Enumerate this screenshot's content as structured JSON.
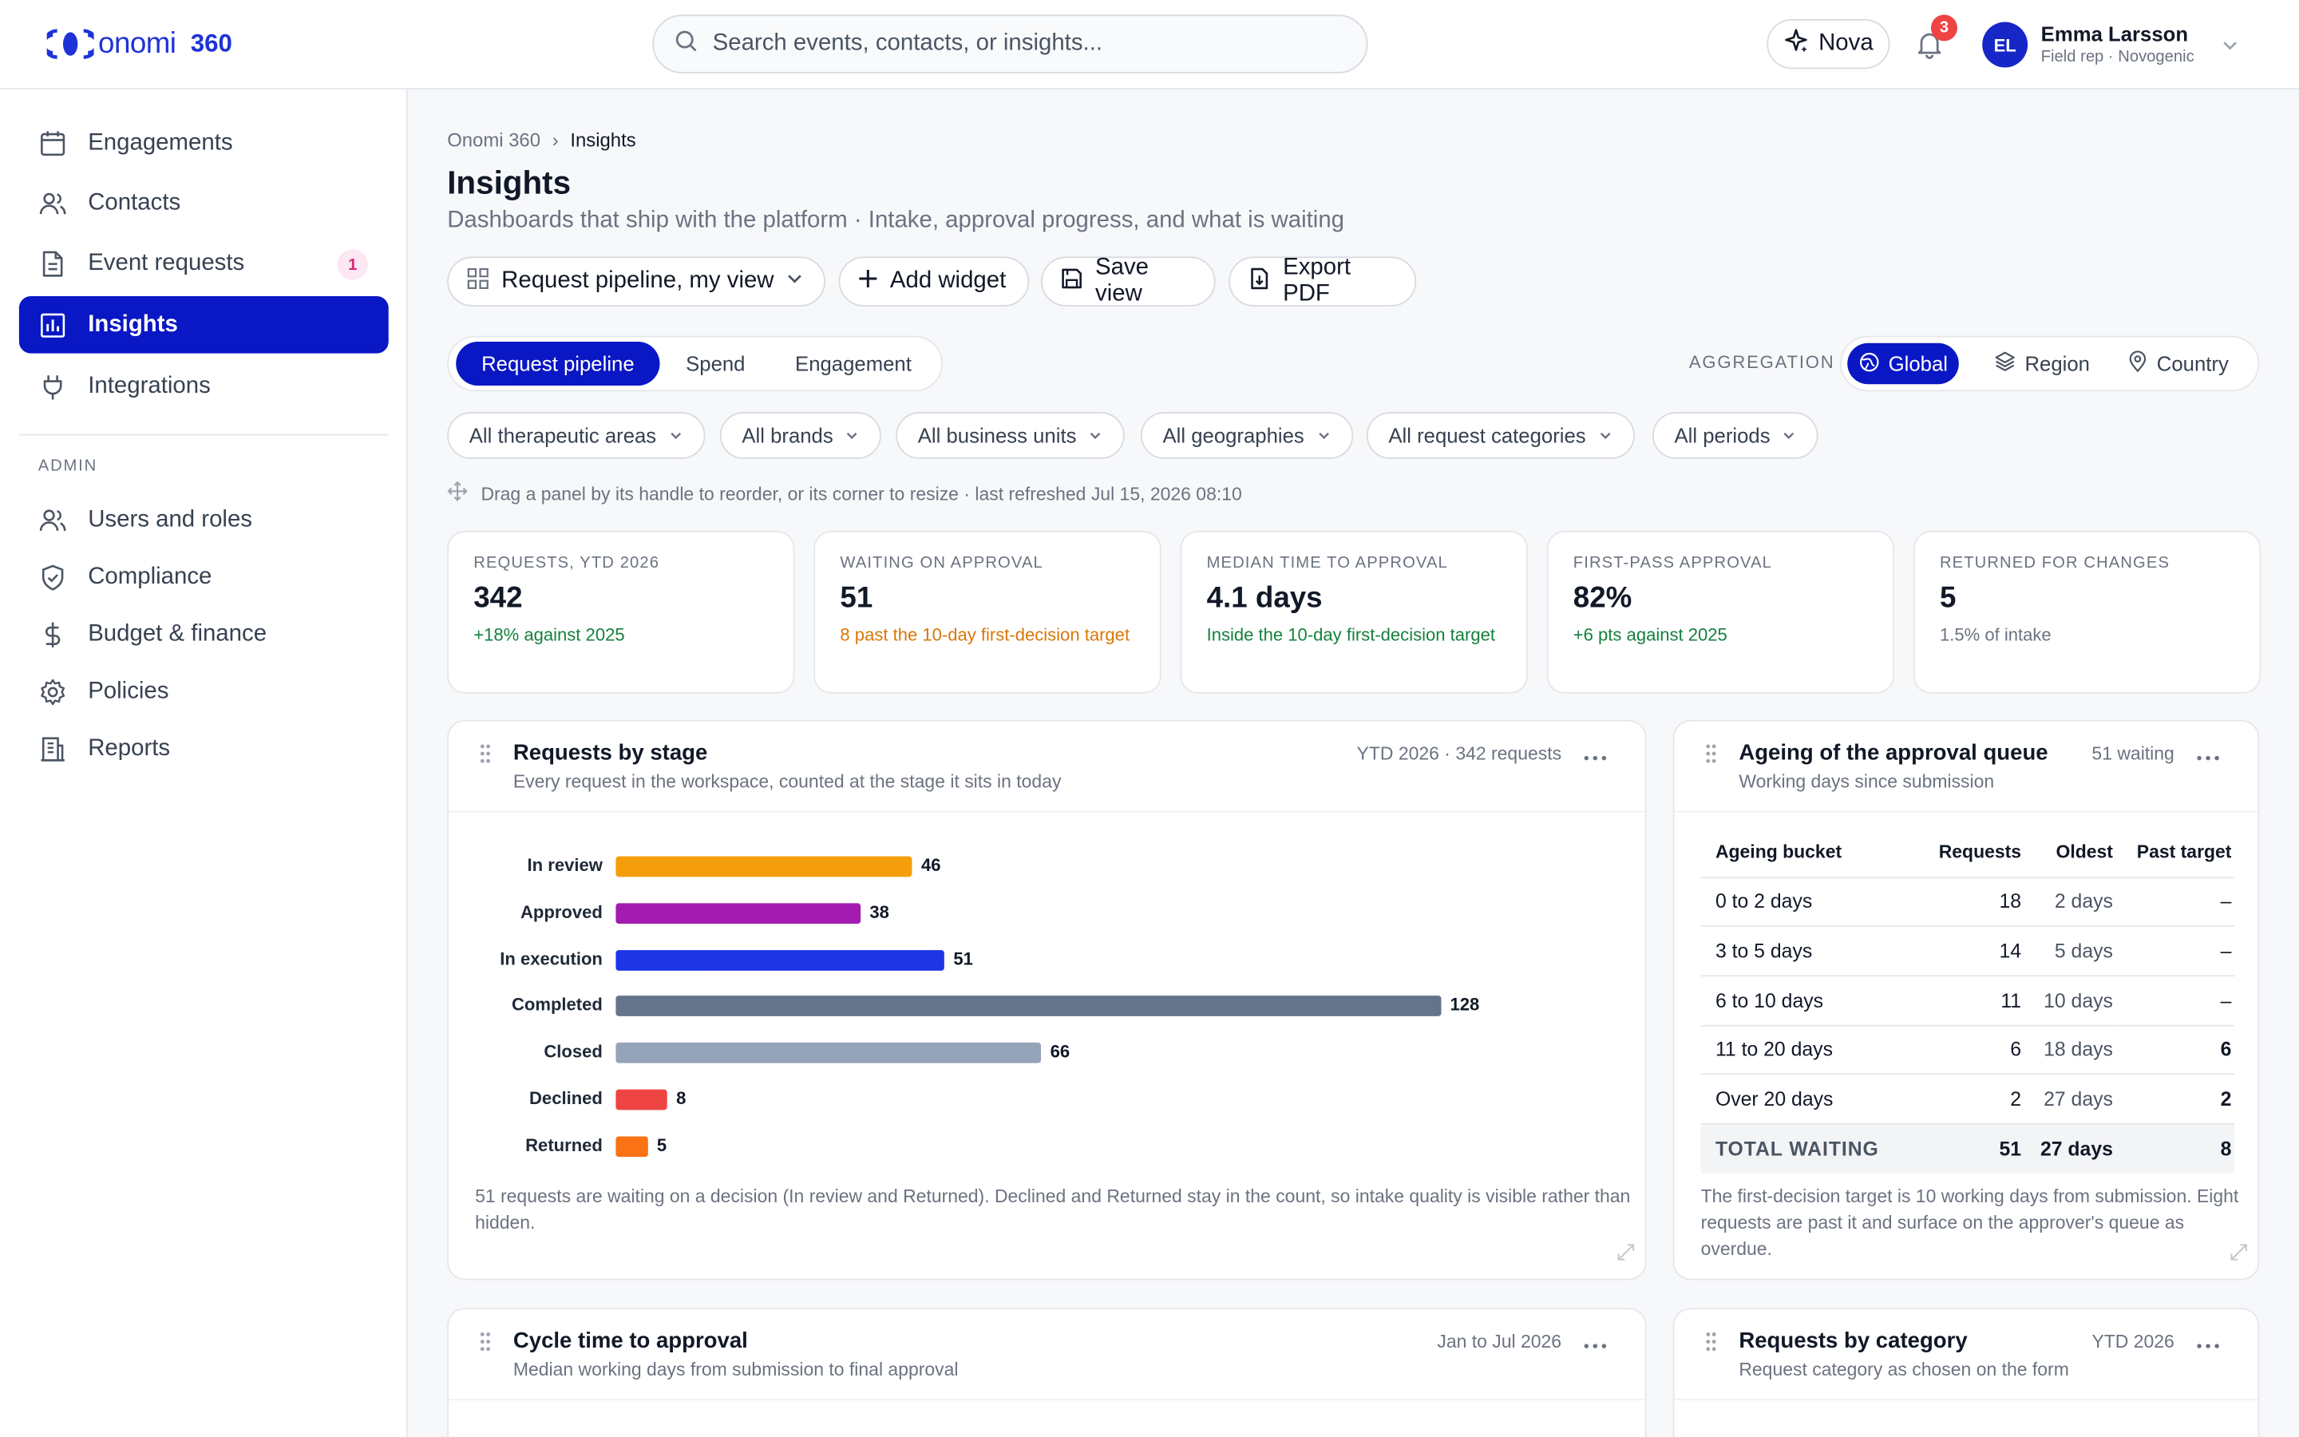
{
  "app": {
    "name": "onomi",
    "suffix": "360"
  },
  "search": {
    "placeholder": "Search events, contacts, or insights..."
  },
  "header": {
    "assistant": "Nova",
    "notifications": "3"
  },
  "user": {
    "initials": "EL",
    "name": "Emma Larsson",
    "role": "Field rep · Novogenic"
  },
  "sidebar": {
    "items": [
      {
        "label": "Engagements",
        "icon": "calendar-icon"
      },
      {
        "label": "Contacts",
        "icon": "users-icon"
      },
      {
        "label": "Event requests",
        "icon": "document-icon",
        "badge": "1"
      },
      {
        "label": "Insights",
        "icon": "bar-chart-icon",
        "active": true
      },
      {
        "label": "Integrations",
        "icon": "plug-icon"
      }
    ],
    "admin_label": "ADMIN",
    "admin_items": [
      {
        "label": "Users and roles",
        "icon": "users-icon"
      },
      {
        "label": "Compliance",
        "icon": "shield-icon"
      },
      {
        "label": "Budget & finance",
        "icon": "dollar-icon"
      },
      {
        "label": "Policies",
        "icon": "gear-icon"
      },
      {
        "label": "Reports",
        "icon": "building-icon"
      }
    ]
  },
  "breadcrumb": {
    "root": "Onomi 360",
    "current": "Insights"
  },
  "page": {
    "title": "Insights",
    "subtitle": "Dashboards that ship with the platform · Intake, approval progress, and what is waiting"
  },
  "toolbar": {
    "view": "Request pipeline, my view",
    "add_widget": "Add widget",
    "save_view": "Save view",
    "export_pdf": "Export PDF"
  },
  "tabs": [
    "Request pipeline",
    "Spend",
    "Engagement"
  ],
  "aggregation": {
    "label": "AGGREGATION",
    "options": [
      "Global",
      "Region",
      "Country"
    ],
    "selected": "Global"
  },
  "filters": [
    "All therapeutic areas",
    "All brands",
    "All business units",
    "All geographies",
    "All request categories",
    "All periods"
  ],
  "hint": "Drag a panel by its handle to reorder, or its corner to resize · last refreshed Jul 15, 2026 08:10",
  "kpis": [
    {
      "label": "REQUESTS, YTD 2026",
      "value": "342",
      "note": "+18% against 2025",
      "tone": "green"
    },
    {
      "label": "WAITING ON APPROVAL",
      "value": "51",
      "note": "8 past the 10-day first-decision target",
      "tone": "orange"
    },
    {
      "label": "MEDIAN TIME TO APPROVAL",
      "value": "4.1 days",
      "note": "Inside the 10-day first-decision target",
      "tone": "green"
    },
    {
      "label": "FIRST-PASS APPROVAL",
      "value": "82%",
      "note": "+6 pts against 2025",
      "tone": "green"
    },
    {
      "label": "RETURNED FOR CHANGES",
      "value": "5",
      "note": "1.5% of intake",
      "tone": "gray"
    }
  ],
  "stage_panel": {
    "title": "Requests by stage",
    "subtitle": "Every request in the workspace, counted at the stage it sits in today",
    "meta": "YTD 2026 · 342 requests",
    "footer": "51 requests are waiting on a decision (In review and Returned). Declined and Returned stay in the count, so intake quality is visible rather than hidden."
  },
  "chart_data": {
    "type": "bar",
    "orientation": "horizontal",
    "categories": [
      "In review",
      "Approved",
      "In execution",
      "Completed",
      "Closed",
      "Declined",
      "Returned"
    ],
    "values": [
      46,
      38,
      51,
      128,
      66,
      8,
      5
    ],
    "colors": [
      "#f59e0b",
      "#a21caf",
      "#1d35e5",
      "#64748b",
      "#94a3b8",
      "#ef4444",
      "#f97316"
    ],
    "xlim": [
      0,
      128
    ]
  },
  "ageing_panel": {
    "title": "Ageing of the approval queue",
    "subtitle": "Working days since submission",
    "meta": "51 waiting",
    "columns": [
      "Ageing bucket",
      "Requests",
      "Oldest",
      "Past target"
    ],
    "rows": [
      {
        "bucket": "0 to 2 days",
        "requests": "18",
        "oldest": "2 days",
        "past": "–"
      },
      {
        "bucket": "3 to 5 days",
        "requests": "14",
        "oldest": "5 days",
        "past": "–"
      },
      {
        "bucket": "6 to 10 days",
        "requests": "11",
        "oldest": "10 days",
        "past": "–"
      },
      {
        "bucket": "11 to 20 days",
        "requests": "6",
        "oldest": "18 days",
        "past": "6"
      },
      {
        "bucket": "Over 20 days",
        "requests": "2",
        "oldest": "27 days",
        "past": "2"
      }
    ],
    "total": {
      "bucket": "TOTAL WAITING",
      "requests": "51",
      "oldest": "27 days",
      "past": "8"
    },
    "footer": "The first-decision target is 10 working days from submission. Eight requests are past it and surface on the approver's queue as overdue."
  },
  "cycle_panel": {
    "title": "Cycle time to approval",
    "subtitle": "Median working days from submission to final approval",
    "meta": "Jan to Jul 2026"
  },
  "category_panel": {
    "title": "Requests by category",
    "subtitle": "Request category as chosen on the form",
    "meta": "YTD 2026"
  }
}
